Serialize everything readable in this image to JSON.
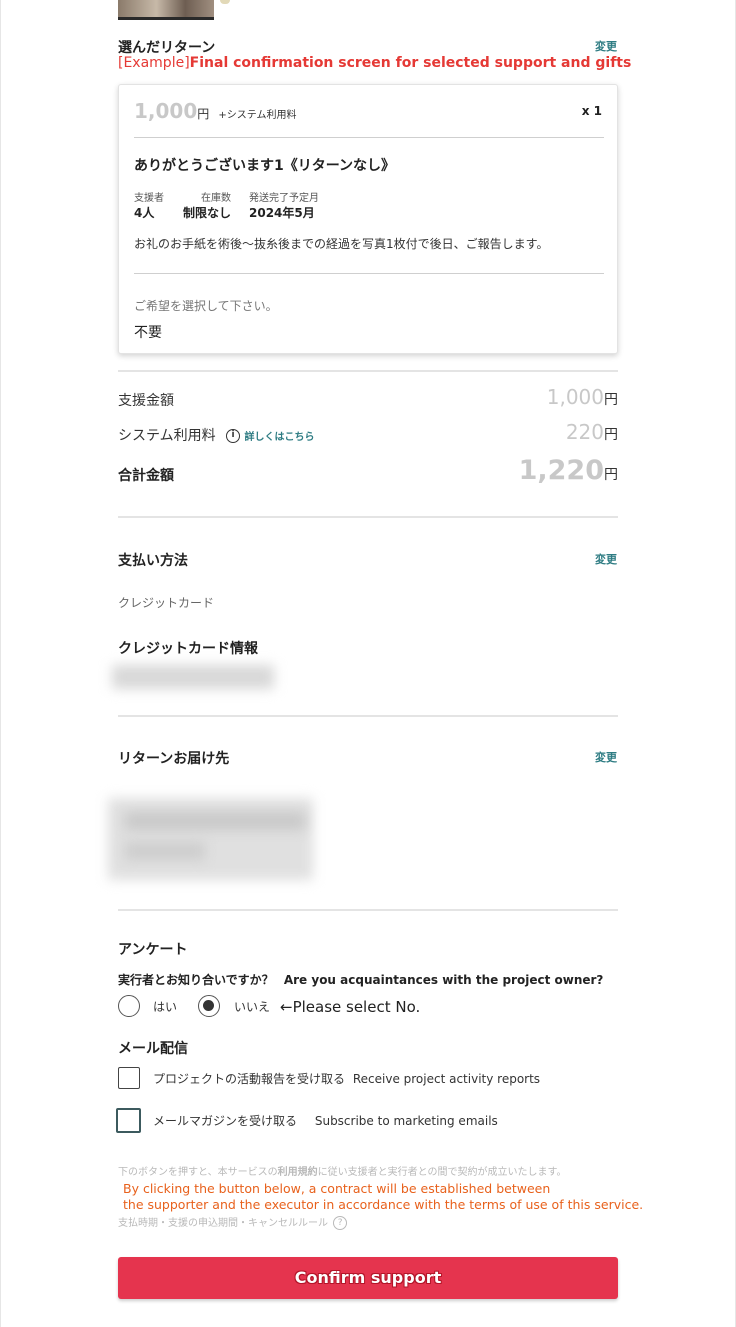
{
  "selected_return": {
    "title": "選んだリターン",
    "change_label": "変更",
    "annotation_prefix": "[Example]",
    "annotation_text": "Final confirmation screen for selected support and gifts",
    "price": "1,000",
    "price_unit": "円",
    "price_suffix": "+システム利用料",
    "quantity": "x 1",
    "return_name": "ありがとうございます1《リターンなし》",
    "meta": [
      {
        "label": "支援者",
        "value": "4人"
      },
      {
        "label": "在庫数",
        "value": "制限なし"
      },
      {
        "label": "発送完了予定月",
        "value": "2024年5月"
      }
    ],
    "description": "お礼のお手紙を術後〜抜糸後までの経過を写真1枚付で後日、ご報告します。",
    "choice_prompt": "ご希望を選択して下さい。",
    "choice_value": "不要"
  },
  "totals": {
    "support_label": "支援金額",
    "support_amount": "1,000",
    "fee_label": "システム利用料",
    "fee_detail_link": "詳しくはこちら",
    "fee_amount": "220",
    "total_label": "合計金額",
    "total_amount": "1,220",
    "yen": "円"
  },
  "payment": {
    "title": "支払い方法",
    "change_label": "変更",
    "method": "クレジットカード",
    "card_info_title": "クレジットカード情報"
  },
  "delivery": {
    "title": "リターンお届け先",
    "change_label": "変更"
  },
  "survey": {
    "title": "アンケート",
    "question": "実行者とお知り合いですか？",
    "question_en": "Are you acquaintances with the project owner?",
    "option_yes": "はい",
    "option_no": "いいえ",
    "selected": "いいえ",
    "hint": "←Please select No."
  },
  "mail": {
    "title": "メール配信",
    "option1_label": "プロジェクトの活動報告を受け取る",
    "option1_en": "Receive project activity reports",
    "option2_label": "メールマガジンを受け取る",
    "option2_en": "Subscribe to marketing emails"
  },
  "terms": {
    "line1_a": "下のボタンを押すと、本サービスの",
    "line1_link": "利用規約",
    "line1_b": "に従い支援者と実行者との間で契約が成立いたします。",
    "line3": "支払時期・支援の申込期間・キャンセルルール",
    "annotation_line1": "By clicking the button below, a contract will be established between",
    "annotation_line2": "the supporter and the executor in accordance with the terms of use of this service."
  },
  "confirm_button": "Confirm support",
  "colors": {
    "accent_teal": "#2e7c83",
    "cta_red": "#e5344e",
    "annotation_red": "#e53935",
    "annotation_orange": "#e8611c"
  },
  "icons": [
    "info-icon",
    "question-icon",
    "radio-icon",
    "checkbox-icon"
  ]
}
